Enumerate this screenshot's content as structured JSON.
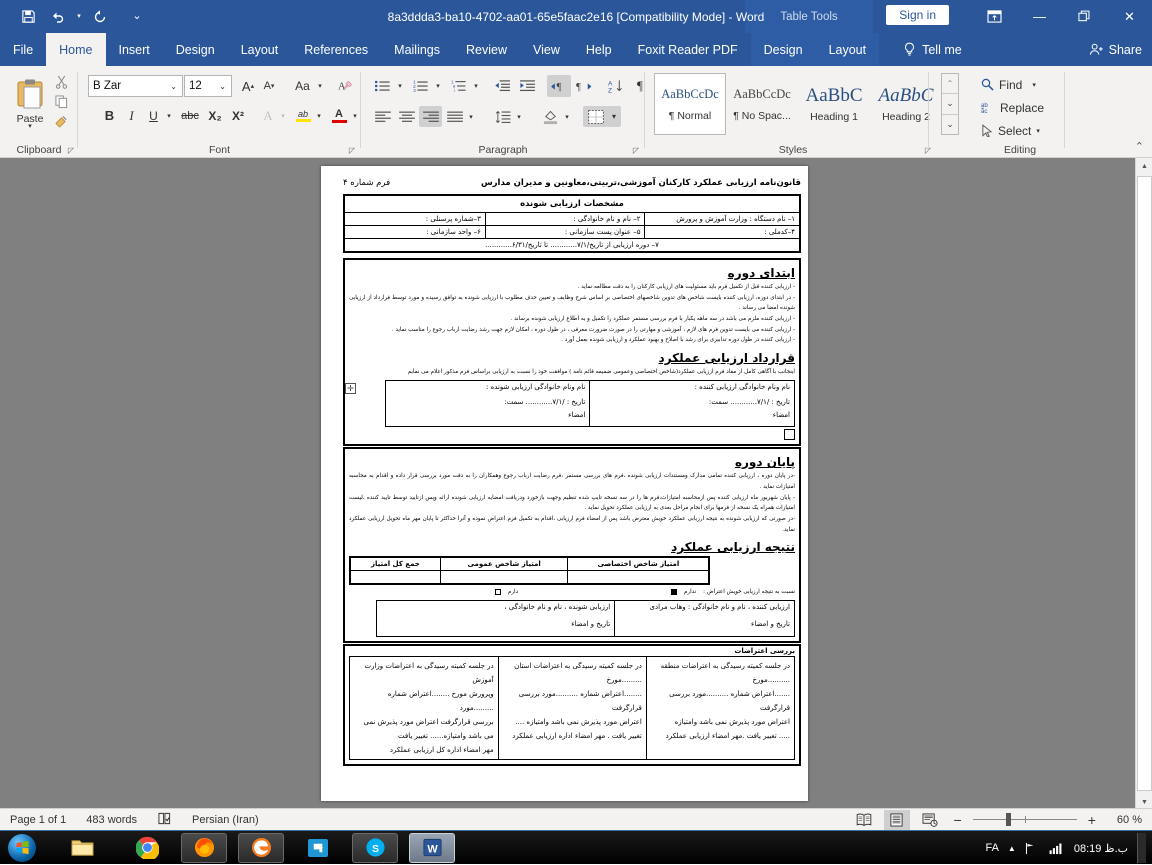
{
  "window": {
    "title": "8a3ddda3-ba10-4702-aa01-65e5faac2e16 [Compatibility Mode]  -  Word",
    "contextual_tools_label": "Table Tools",
    "sign_in": "Sign in",
    "minimize": "—",
    "restore": "❐",
    "close": "✕",
    "ribbon_display_icon": "ribbon-display-options-icon"
  },
  "quick_access": [
    {
      "name": "save-icon",
      "glyph": "💾"
    },
    {
      "name": "undo-icon",
      "glyph": "↶"
    },
    {
      "name": "redo-icon",
      "glyph": "↻"
    },
    {
      "name": "customize-qat-icon",
      "glyph": "⌄"
    }
  ],
  "tabs": [
    {
      "label": "File",
      "active": false
    },
    {
      "label": "Home",
      "active": true
    },
    {
      "label": "Insert",
      "active": false
    },
    {
      "label": "Design",
      "active": false
    },
    {
      "label": "Layout",
      "active": false
    },
    {
      "label": "References",
      "active": false
    },
    {
      "label": "Mailings",
      "active": false
    },
    {
      "label": "Review",
      "active": false
    },
    {
      "label": "View",
      "active": false
    },
    {
      "label": "Help",
      "active": false
    },
    {
      "label": "Foxit Reader PDF",
      "active": false
    }
  ],
  "contextual_tabs": [
    {
      "label": "Design"
    },
    {
      "label": "Layout"
    }
  ],
  "tell_me": "Tell me",
  "share": "Share",
  "ribbon": {
    "clipboard": {
      "label": "Clipboard",
      "paste": "Paste",
      "cut": "cut-icon",
      "copy": "copy-icon",
      "format_painter": "format-painter-icon"
    },
    "font": {
      "label": "Font",
      "font_name": "B Zar",
      "font_size": "12",
      "grow": "A▴",
      "shrink": "A▾",
      "change_case": "Aa",
      "clear_formatting": "clear-formatting-icon",
      "bold": "B",
      "italic": "I",
      "underline": "U",
      "strikethrough": "abc",
      "subscript": "X₂",
      "superscript": "X²",
      "text_effects": "A",
      "highlight": "ab",
      "font_color": "A"
    },
    "paragraph": {
      "label": "Paragraph",
      "bullets": "bullets-icon",
      "numbering": "numbering-icon",
      "multilevel": "multilevel-list-icon",
      "decrease_indent": "decrease-indent-icon",
      "increase_indent": "increase-indent-icon",
      "ltr": "left-to-right-icon",
      "rtl": "right-to-left-icon",
      "sort": "sort-icon",
      "show_marks": "¶",
      "align_left": "align-left-icon",
      "align_center": "align-center-icon",
      "align_right": "align-right-icon",
      "justify": "justify-icon",
      "line_spacing": "line-spacing-icon",
      "shading": "shading-icon",
      "borders": "borders-icon"
    },
    "styles": {
      "label": "Styles",
      "items": [
        {
          "preview": "AaBbCcDc",
          "name": "¶ Normal",
          "selected": true
        },
        {
          "preview": "AaBbCcDc",
          "name": "¶ No Spac...",
          "selected": false
        },
        {
          "preview": "AaBbC",
          "name": "Heading 1",
          "selected": false
        },
        {
          "preview": "AaBbC",
          "name": "Heading 2",
          "selected": false
        }
      ]
    },
    "editing": {
      "label": "Editing",
      "find": "Find",
      "replace": "Replace",
      "select": "Select"
    },
    "collapse_ribbon": "collapse-ribbon-icon"
  },
  "document": {
    "form_number": "فرم شماره ۴",
    "title": "قانون‌نامه ارزیابی عملکرد کارکنان آموزشی،تربیتی،معاونین و مدیران مدارس",
    "info_table": {
      "header": "مشخصات ارزیابی شونده",
      "row1": [
        "۱– نام دستگاه : وزارت آموزش و پرورش",
        "۲– نام و نام خانوادگی :",
        "۳–شماره پرسنلی :"
      ],
      "row2": [
        "۴–کدملی :",
        "۵– عنوان پست سازمانی :",
        "۶– واحد سازمانی :"
      ],
      "row3": "۷– دوره ارزیابی از تاریخ/۷/۱............ تا تاریخ/۶/۳۱............"
    },
    "section_start": {
      "heading": "ابتدای دوره",
      "bullets": [
        "- ارزیابی کننده قبل از تکمیل فرم باید مسئولیت های ارزیابی کارکنان را به دقت مطالعه نماید .",
        "- در ابتدای دوره، ارزیابی کننده بایست شاخص های تدوین شاخصهای اختصاصی بر اساس شرح وظایف و تعیین حدف مطلوب با ارزیابی شونده به توافق رسیده و مورد توسط فرارداد از ارزیابی شونده امضا می رساند .",
        "- ارزیابی کننده ملزم می باشد در سه ماهه یکبار با فرم بررسی مستمر عملکرد را تکمیل و به اطلاع ارزیابی شونده برساند .",
        "- ارزیابی کننده می بایست تدوین فرم های لازم ، آموزشی و مهارتی را در صورت ضرورت معرفی ، در طول دوره ، امکان لازم جهت رشد رضایت ارباب رجوع را مناسب نماید .",
        "- ارزیابی کننده در طول دوره تدابیری برای رشد با اصلاح و بهبود عملکرد و ارزیابی شونده بعمل آورد ."
      ]
    },
    "section_contract": {
      "heading": "قرارداد ارزیابی عملکرد",
      "intro": "اینجانب با آگاهی کامل از مفاد فرم ارزیابی عملکرد(شاخص اختصاصی وعمومی ضمیمه قائم نامه ) موافقت خود را نسبت به ارزیابی براساس فرم مذکور اعلام می نمایم",
      "left_cell": [
        "نام ونام خانوادگی ارزیابی کننده :",
        "تاریخ :      /۷/۱............      سمت:",
        "امضاء"
      ],
      "right_cell": [
        "نام ونام خانوادگی ارزیابی شونده :",
        "تاریخ :      /۷/۱............      سمت:",
        "امضاء"
      ]
    },
    "section_end": {
      "heading": "پایان دوره",
      "bullets": [
        "-در پایان دوره ، ارزیابی کننده تمامی مدارک ومستندات ارزیابی شونده ،فرم های بررسی مستمر ،فرم رضایت ارباب رجوع وهمکاران را به دقت مورد بررسی قرار داده و اقدام به محاسبه امتیازات نماید .",
        "- پایان شهریور ماه ارزیابی کننده پس ازمحاسبه امتیازات،فرم ها را در سه نسخه تایپ شده تنظیم وجهت بازخورد ودریافت امضایه ارزیابی شونده ارائه وپس ازتایید توسط تایید کننده ،لیست امتیازات همراه یک نسخه از فرمها برای انجام مراحل بعدی به ارزیابی عملکرد تحویل نماید .",
        "-در صورتی که ارزیابی شونده به نتیجه ارزیابی عملکرد خویش معترض باشد پس از امضاء فرم ارزیابی ،اقدام به تکمیل فرم اعتراض نموده و آنرا حداکثر تا پایان مهر ماه تحویل ارزیابی عملکرد نماید."
      ]
    },
    "section_result": {
      "heading": "نتیجه ارزیابی عملکرد",
      "score_headers": [
        "امتیاز شاخص اختصاصی",
        "امتیاز شاخص عمومی",
        "جمع کل امتیاز"
      ],
      "score_values": [
        "",
        "",
        ""
      ],
      "objection_label": "نسبت به نتیجه ارزیابی خویش اعتراض :",
      "objection_no": "ندارم",
      "objection_yes": "دارم",
      "signer_right": [
        "ارزیابی شونده ، نام و نام خانوادگی  ،",
        "تاریخ و امضاء"
      ],
      "signer_left": [
        "ارزیابی کننده ، نام و نام خانوادگی  : وهاب مرادی",
        "تاریخ و امضاء"
      ]
    },
    "section_objections": {
      "heading": "بررسی اعتراضات",
      "cells": [
        [
          "در جلسه کمیته رسیدگی به اعتراضات منطقه ..........مورخ",
          ".......اعتراض شماره ..........مورد بررسی قرارگرفت",
          "اعتراض مورد پذیرش نمی باشد     وامتیازه",
          "..... تغییر یافت .مهر امضاء ارزیابی عملکرد"
        ],
        [
          "در جلسه کمیته رسیدگی به اعتراضات استان .........مورخ",
          "........اعتراض شماره ..........مورد بررسی قرارگرفت",
          "اعتراض مورد پذیرش نمی باشد     وامتیازه ....",
          "تغییر یافت . مهر امضاء اداره ارزیابی عملکرد"
        ],
        [
          "در جلسه کمیته رسیدگی به اعتراضات وزارت آموزش",
          "وپرورش مورخ ........اعتراض شماره .........مورد",
          "بررسی قرارگرفت اعتراض مورد پذیرش نمی",
          "می باشد     وامتیازه...... تغییر یافت",
          "مهر امضاء اداره کل  ارزیابی عملکرد"
        ]
      ]
    }
  },
  "status_bar": {
    "page": "Page 1 of 1",
    "words": "483 words",
    "proofing_icon": "proofing-errors-icon",
    "language": "Persian (Iran)",
    "view_read": "read-mode-icon",
    "view_print": "print-layout-icon",
    "view_web": "web-layout-icon",
    "zoom_out": "−",
    "zoom_in": "+",
    "zoom_level": "60 %"
  },
  "taskbar": {
    "start": "start-orb-icon",
    "items": [
      {
        "name": "file-explorer-icon",
        "glyph": "📁",
        "style": "plain"
      },
      {
        "name": "google-chrome-icon",
        "glyph": "",
        "style": "plain"
      },
      {
        "name": "firefox-icon",
        "glyph": "",
        "style": "framed"
      },
      {
        "name": "edge-legacy-icon",
        "glyph": "",
        "style": "framed"
      },
      {
        "name": "foxit-reader-icon",
        "glyph": "",
        "style": "plain"
      },
      {
        "name": "skype-icon",
        "glyph": "S",
        "style": "framed"
      },
      {
        "name": "word-taskbar-icon",
        "glyph": "W",
        "style": "active"
      }
    ],
    "tray": {
      "language": "FA",
      "show_hidden_icons": "▲",
      "network_icon": "network-icon",
      "volume_icon": "volume-icon",
      "clock": "ب.ظ 08:19"
    }
  }
}
